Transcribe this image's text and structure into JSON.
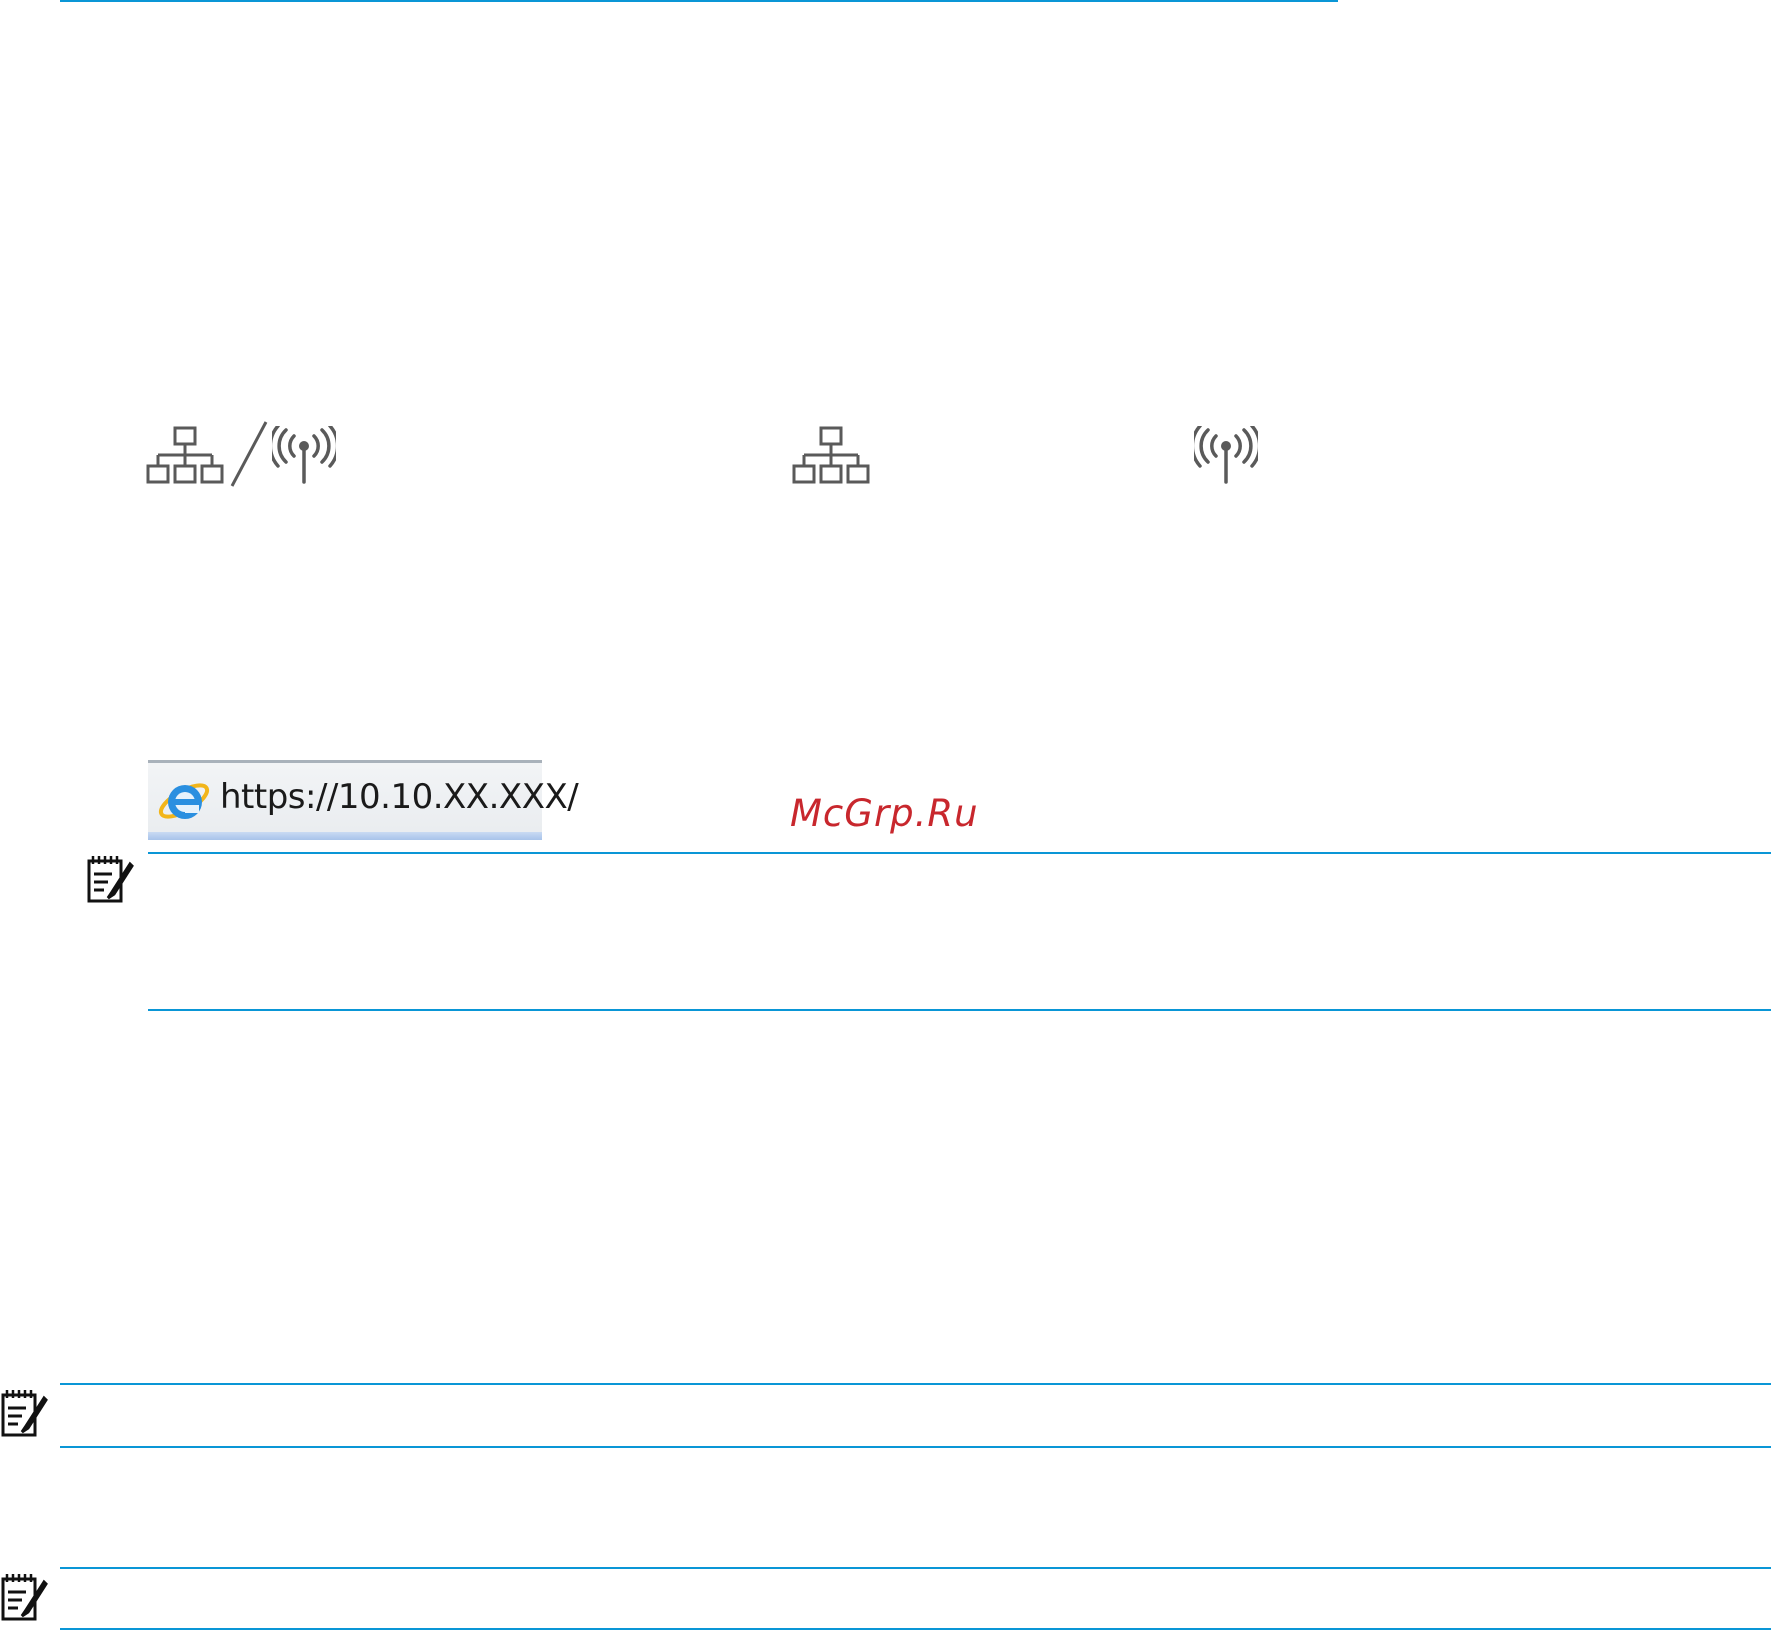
{
  "colors": {
    "rule": "#0a96d6",
    "icon_gray": "#5a5a5a",
    "watermark": "#c8272d"
  },
  "icons": [
    "ethernet-icon",
    "slash-separator",
    "wireless-icon",
    "note-icon",
    "internet-explorer-icon"
  ],
  "browser": {
    "url": "https://10.10.XX.XXX/"
  },
  "watermark": "McGrp.Ru"
}
